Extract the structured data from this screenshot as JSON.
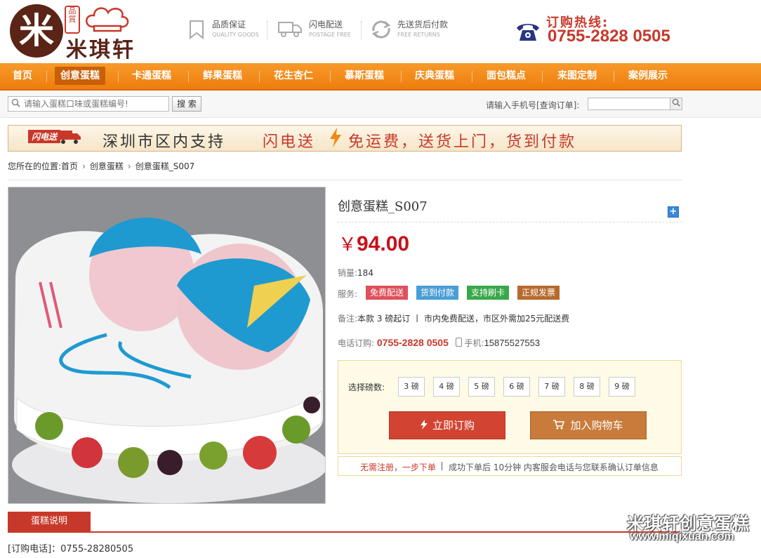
{
  "brand": {
    "name": "米琪轩",
    "stamp": "品質"
  },
  "features": [
    {
      "title": "品质保证",
      "subtitle": "QUALITY GOODS",
      "icon": "bookmark-icon"
    },
    {
      "title": "闪电配送",
      "subtitle": "POSTAGE FREE",
      "icon": "truck-icon"
    },
    {
      "title": "先送货后付款",
      "subtitle": "FREE RETURNS",
      "icon": "return-icon"
    }
  ],
  "hotline": {
    "label": "订购热线:",
    "number": "0755-2828 0505",
    "icon": "telephone-icon"
  },
  "nav": {
    "items": [
      "首页",
      "创意蛋糕",
      "卡通蛋糕",
      "鲜果蛋糕",
      "花生杏仁",
      "慕斯蛋糕",
      "庆典蛋糕",
      "面包糕点",
      "来图定制",
      "案例展示"
    ],
    "active_index": 1
  },
  "search": {
    "placeholder": "请输入蛋糕口味或蛋糕编号!",
    "button": "搜 索",
    "query_label": "请输入手机号[查询订单]:"
  },
  "banner": {
    "badge": "闪电送",
    "text_a": "深圳市区内支持",
    "text_b": "闪电送",
    "text_c": "免运费，送货上门，货到付款"
  },
  "breadcrumb": {
    "prefix": "您所在的位置:",
    "items": [
      "首页",
      "创意蛋糕",
      "创意蛋糕_S007"
    ]
  },
  "product": {
    "title": "创意蛋糕_S007",
    "currency": "￥",
    "price": "94.00",
    "sales_label": "销量:",
    "sales": "184",
    "services_label": "服务:",
    "services": [
      {
        "label": "免费配送",
        "color": "#e0505a"
      },
      {
        "label": "货到付款",
        "color": "#4a9ed6"
      },
      {
        "label": "支持刷卡",
        "color": "#3aa84a"
      },
      {
        "label": "正规发票",
        "color": "#b86a2e"
      }
    ],
    "note_label": "备注:",
    "note_text": "本款 3 磅起订 丨 市内免费配送，市区外需加25元配送费",
    "phone_label": "电话订购:",
    "phone": "0755-2828 0505",
    "mobile_label": "手机:",
    "mobile": "15875527553",
    "weight_label": "选择磅数:",
    "weights": [
      "3 磅",
      "4 磅",
      "5 磅",
      "6 磅",
      "7 磅",
      "8 磅",
      "9 磅"
    ],
    "buy_label": "立即订购",
    "cart_label": "加入购物车",
    "tip_a": "无需注册，一步下单",
    "tip_b": "成功下单后 10分钟 内客服会电话与您联系确认订单信息"
  },
  "tabs": {
    "active": "蛋糕说明"
  },
  "order_tel": "[订购电话]：0755-28280505",
  "watermark": {
    "line1": "米琪轩创意蛋糕",
    "line2": "www.miqixuan.com"
  }
}
